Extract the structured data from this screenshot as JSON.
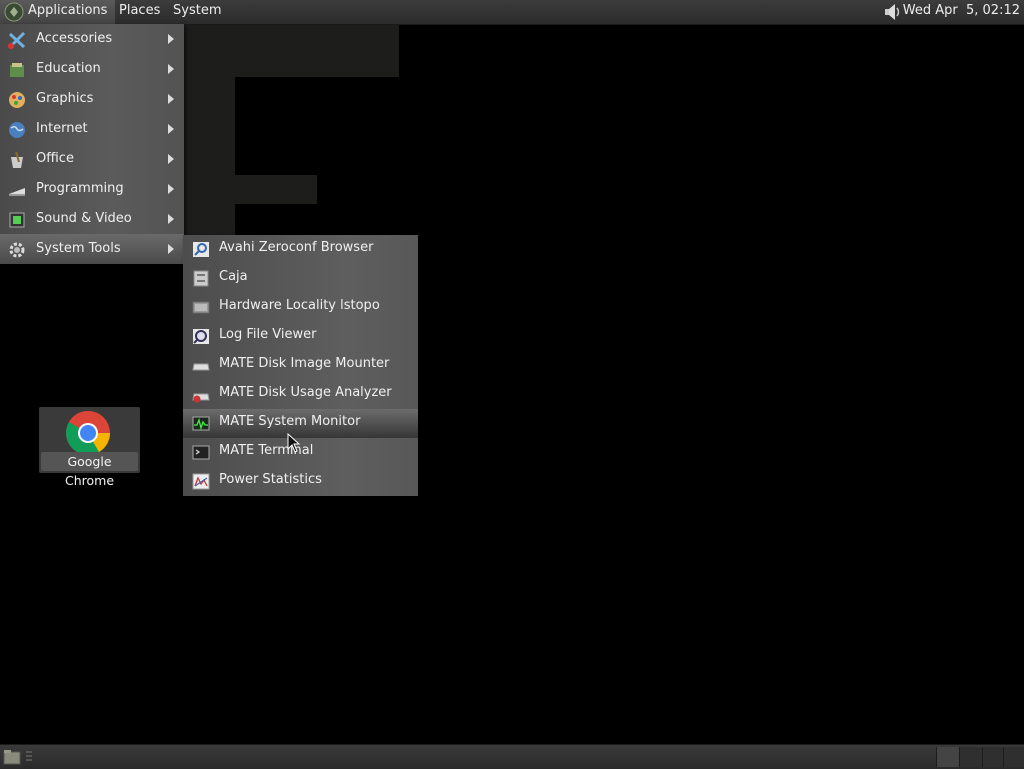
{
  "top_panel": {
    "menus": [
      "Applications",
      "Places",
      "System"
    ],
    "clock": "Wed Apr  5, 02:12"
  },
  "apps_menu": {
    "items": [
      {
        "label": "Accessories",
        "icon": "accessories-icon"
      },
      {
        "label": "Education",
        "icon": "education-icon"
      },
      {
        "label": "Graphics",
        "icon": "graphics-icon"
      },
      {
        "label": "Internet",
        "icon": "internet-icon"
      },
      {
        "label": "Office",
        "icon": "office-icon"
      },
      {
        "label": "Programming",
        "icon": "programming-icon"
      },
      {
        "label": "Sound & Video",
        "icon": "sound-video-icon"
      },
      {
        "label": "System Tools",
        "icon": "system-tools-icon"
      }
    ],
    "highlighted": "System Tools"
  },
  "system_tools_menu": {
    "items": [
      {
        "label": "Avahi Zeroconf Browser",
        "icon": "avahi-icon"
      },
      {
        "label": "Caja",
        "icon": "file-cabinet-icon"
      },
      {
        "label": "Hardware Locality lstopo",
        "icon": "hardware-icon"
      },
      {
        "label": "Log File Viewer",
        "icon": "log-viewer-icon"
      },
      {
        "label": "MATE Disk Image Mounter",
        "icon": "disk-mounter-icon"
      },
      {
        "label": "MATE Disk Usage Analyzer",
        "icon": "disk-usage-icon"
      },
      {
        "label": "MATE System Monitor",
        "icon": "system-monitor-icon"
      },
      {
        "label": "MATE Terminal",
        "icon": "terminal-icon"
      },
      {
        "label": "Power Statistics",
        "icon": "power-stats-icon"
      }
    ],
    "highlighted": "MATE System Monitor"
  },
  "desktop": {
    "icons": [
      {
        "label": "Google Chrome",
        "icon": "chrome-icon"
      }
    ]
  }
}
